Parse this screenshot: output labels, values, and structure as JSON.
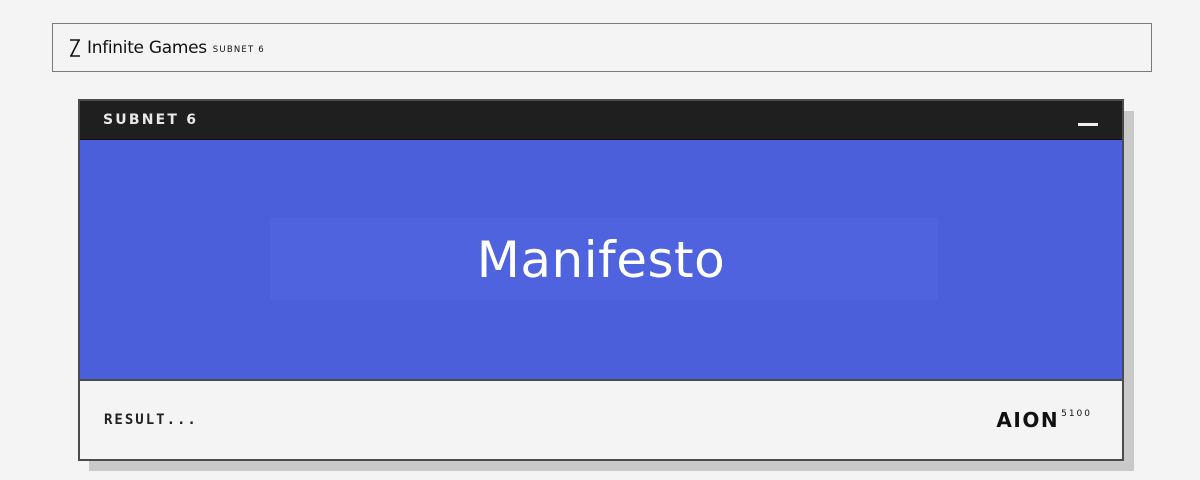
{
  "header": {
    "brand_name": "Infinite Games",
    "brand_sub": "SUBNET 6",
    "logo_icon": "infinite-games-logo-icon"
  },
  "window": {
    "title": "SUBNET 6",
    "minimize_icon": "minimize-icon",
    "banner_title": "Manifesto",
    "banner_color": "#4a5fd9",
    "footer_status": "RESULT...",
    "footer_brand": "AION",
    "footer_brand_sup": "5100"
  }
}
